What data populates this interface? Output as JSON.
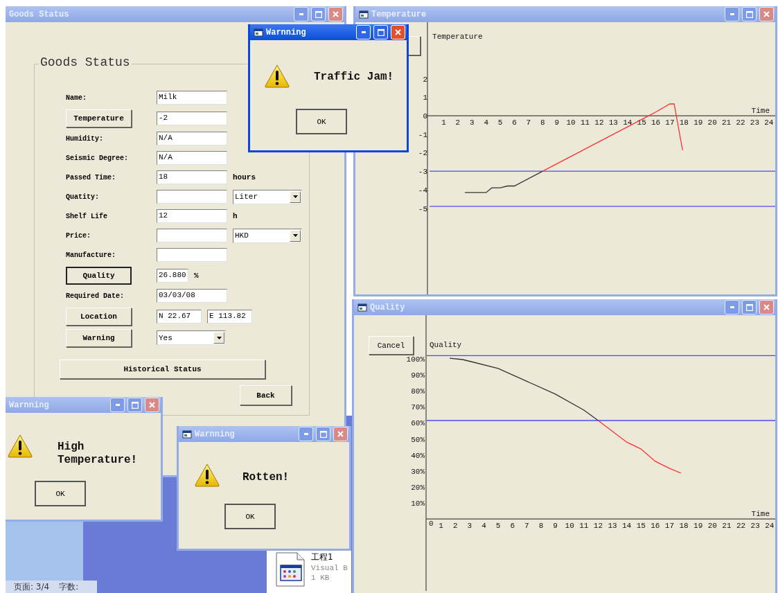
{
  "goods_status_window": {
    "title": "Goods Status",
    "active": false,
    "group_title": "Goods Status",
    "rows": [
      {
        "kind": "field",
        "label": "Name:",
        "value": "Milk"
      },
      {
        "kind": "button_field",
        "button": "Temperature",
        "default": false,
        "value": "-2"
      },
      {
        "kind": "field",
        "label": "Humidity:",
        "value": "N/A"
      },
      {
        "kind": "field",
        "label": "Seismic Degree:",
        "value": "N/A"
      },
      {
        "kind": "field",
        "label": "Passed Time:",
        "value": "18",
        "unit": "hours"
      },
      {
        "kind": "field",
        "label": "Quatity:",
        "combo": "Liter"
      },
      {
        "kind": "field",
        "label": "Shelf Life",
        "value": "12",
        "unit": "h"
      },
      {
        "kind": "field",
        "label": "Price:",
        "combo": "HKD"
      },
      {
        "kind": "field",
        "label": "Manufacture:"
      },
      {
        "kind": "button_field",
        "button": "Quality",
        "default": true,
        "value": "26.880",
        "unit": "%"
      },
      {
        "kind": "field",
        "label": "Required Date:",
        "value": "03/03/08"
      },
      {
        "kind": "button_pair",
        "button": "Location",
        "default": false,
        "values": [
          "N 22.67",
          "E 113.82"
        ]
      },
      {
        "kind": "button_combo",
        "button": "Warning",
        "default": false,
        "combo": "Yes"
      }
    ],
    "history_button": "Historical Status",
    "back_button": "Back"
  },
  "temperature_window": {
    "title": "Temperature",
    "active": false,
    "chart_data": {
      "type": "line",
      "title": "Temperature",
      "xlabel": "Time",
      "x": [
        2.5,
        4,
        4.4,
        5,
        5.5,
        6,
        8,
        15.5,
        16,
        17,
        17.3,
        17.9
      ],
      "series": [
        {
          "color": "#333333",
          "values": [
            -4.15,
            -4.15,
            -3.9,
            -3.9,
            -3.8,
            -3.8,
            -3,
            null,
            null,
            null,
            null,
            null
          ]
        },
        {
          "color": "#ff3030",
          "values": [
            null,
            null,
            null,
            null,
            null,
            null,
            -3,
            0,
            0.2,
            0.64,
            0.64,
            -1.87
          ]
        }
      ],
      "xlim": [
        -0.15,
        24.45
      ],
      "ylim": [
        -9.66,
        5.06
      ],
      "xticks": [
        1,
        2,
        3,
        4,
        5,
        6,
        7,
        8,
        9,
        10,
        11,
        12,
        13,
        14,
        15,
        16,
        17,
        18,
        19,
        20,
        21,
        22,
        23,
        24
      ],
      "yticks": [
        -5,
        -4,
        -3,
        -2,
        -1,
        0,
        1,
        2
      ],
      "ref_lines": [
        {
          "axis": "y",
          "value": -3,
          "color": "#4a4af0"
        },
        {
          "axis": "y",
          "value": -4.9,
          "color": "#4a4af0"
        }
      ]
    }
  },
  "quality_window": {
    "title": "Quality",
    "active": false,
    "cancel_button": "Cancel",
    "chart_data": {
      "type": "line",
      "title": "Quality",
      "xlabel": "Time",
      "x": [
        1.6,
        2.5,
        3,
        5,
        7,
        9,
        11,
        12,
        14,
        15,
        16,
        17,
        17.8
      ],
      "series": [
        {
          "color": "#333333",
          "values": [
            100.4,
            99.6,
            98.5,
            94,
            86,
            78,
            68,
            61.5,
            null,
            null,
            null,
            null,
            null
          ]
        },
        {
          "color": "#ff3030",
          "values": [
            null,
            null,
            null,
            null,
            null,
            null,
            null,
            61.5,
            48,
            43.7,
            36,
            31.6,
            28.6
          ]
        }
      ],
      "xlim": [
        -0.05,
        24.4
      ],
      "ylim": [
        -45,
        127.3
      ],
      "xticks": [
        0,
        1,
        2,
        3,
        4,
        5,
        6,
        7,
        8,
        9,
        10,
        11,
        12,
        13,
        14,
        15,
        16,
        17,
        18,
        19,
        20,
        21,
        22,
        23,
        24
      ],
      "yticks": [
        {
          "value": 10,
          "label": "10%"
        },
        {
          "value": 20,
          "label": "20%"
        },
        {
          "value": 30,
          "label": "30%"
        },
        {
          "value": 40,
          "label": "40%"
        },
        {
          "value": 50,
          "label": "50%"
        },
        {
          "value": 60,
          "label": "60%"
        },
        {
          "value": 70,
          "label": "70%"
        },
        {
          "value": 80,
          "label": "80%"
        },
        {
          "value": 90,
          "label": "90%"
        },
        {
          "value": 100,
          "label": "100%"
        }
      ],
      "ref_lines": [
        {
          "axis": "y",
          "value": 102,
          "color": "#4a4af0"
        },
        {
          "axis": "y",
          "value": 61.5,
          "color": "#4a4af0"
        }
      ]
    }
  },
  "warning_dialogs": [
    {
      "title": "Warnning",
      "active": true,
      "message": "Traffic Jam!",
      "ok_button": "OK"
    },
    {
      "title": "Warnning",
      "active": false,
      "message": "High Temperature!",
      "ok_button": "OK"
    },
    {
      "title": "Warnning",
      "active": false,
      "message": "Rotten!",
      "ok_button": "OK"
    }
  ],
  "desktop": {
    "status_bar": [
      "页面: 3/4",
      "字数:"
    ],
    "file": {
      "name": "工程1",
      "type": "Visual B",
      "size": "1 KB"
    }
  }
}
